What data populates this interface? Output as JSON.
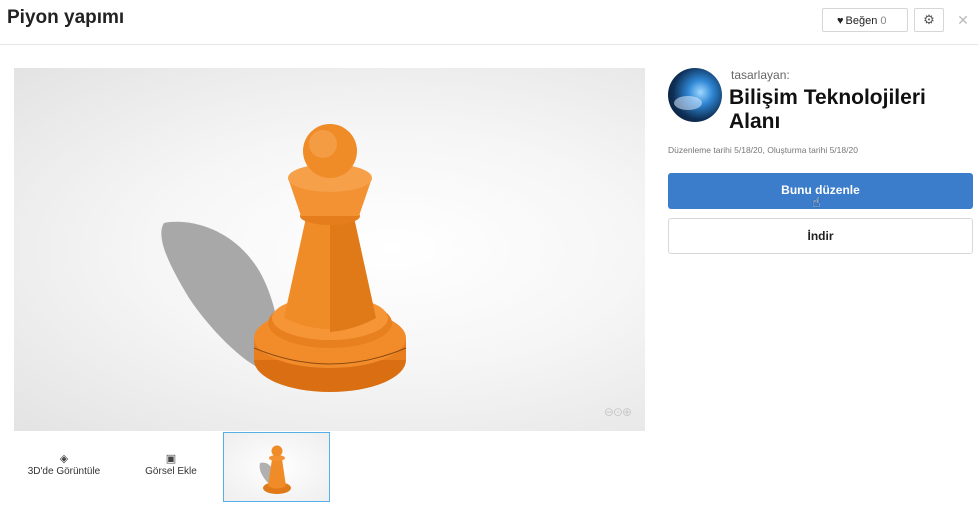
{
  "header": {
    "title": "Piyon yapımı",
    "like_label": "Beğen",
    "like_count": "0",
    "heart_glyph": "♥",
    "gear_glyph": "⚙",
    "close_glyph": "✕"
  },
  "viewer": {
    "controls_glyphs": "⊖⊙⊕",
    "model_color": "#f08c28"
  },
  "tools": {
    "view3d_label": "3D'de Görüntüle",
    "add_image_label": "Görsel Ekle"
  },
  "designer": {
    "by_label": "tasarlayan:",
    "name": "Bilişim Teknolojileri Alanı",
    "dates": "Düzenleme tarihi 5/18/20, Oluşturma tarihi 5/18/20"
  },
  "actions": {
    "edit_label": "Bunu düzenle",
    "download_label": "İndir",
    "edit_color": "#3b7ccb"
  }
}
